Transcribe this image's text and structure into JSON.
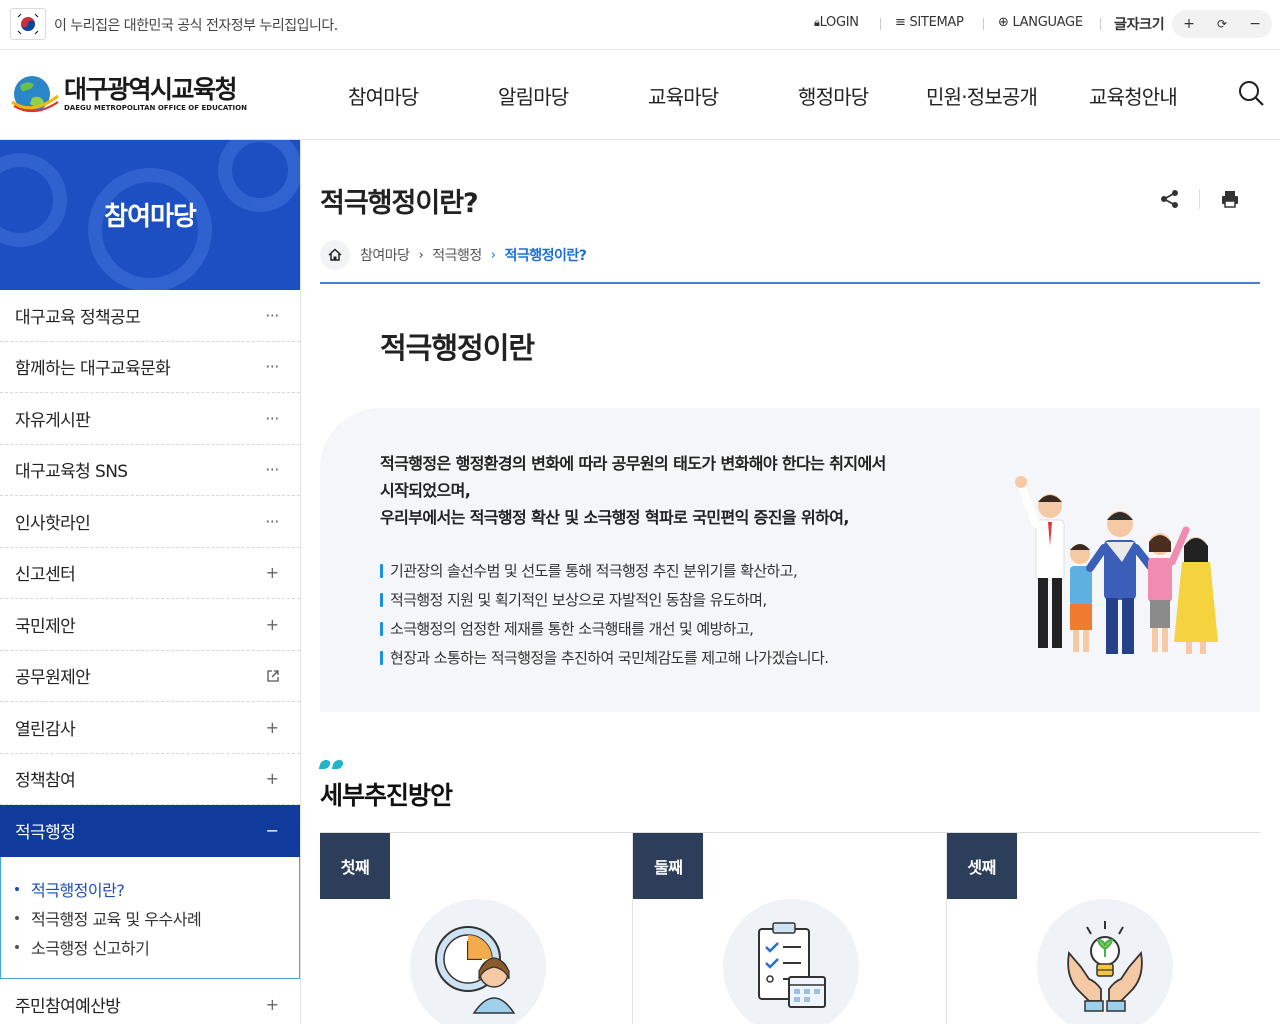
{
  "topbar": {
    "gov_notice": "이 누리집은 대한민국 공식 전자정부 누리집입니다.",
    "login": "LOGIN",
    "sitemap": "SITEMAP",
    "language": "LANGUAGE",
    "font_size_label": "글자크기",
    "font_plus": "+",
    "font_reset": "⟳",
    "font_minus": "−"
  },
  "logo": {
    "title": "대구광역시교육청",
    "subtitle": "DAEGU METROPOLITAN OFFICE OF EDUCATION"
  },
  "gnb": {
    "items": [
      "참여마당",
      "알림마당",
      "교육마당",
      "행정마당",
      "민원·정보공개",
      "교육청안내"
    ]
  },
  "lnb": {
    "title": "참여마당",
    "items": [
      {
        "label": "대구교육 정책공모",
        "mark": "···"
      },
      {
        "label": "함께하는 대구교육문화",
        "mark": "···"
      },
      {
        "label": "자유게시판",
        "mark": "···"
      },
      {
        "label": "대구교육청 SNS",
        "mark": "···"
      },
      {
        "label": "인사핫라인",
        "mark": "···"
      },
      {
        "label": "신고센터",
        "mark": "+"
      },
      {
        "label": "국민제안",
        "mark": "+"
      },
      {
        "label": "공무원제안",
        "mark": "external"
      },
      {
        "label": "열린감사",
        "mark": "+"
      },
      {
        "label": "정책참여",
        "mark": "+"
      },
      {
        "label": "적극행정",
        "mark": "−"
      }
    ],
    "subitems": [
      "적극행정이란?",
      "적극행정 교육 및 우수사례",
      "소극행정 신고하기"
    ],
    "after": {
      "label": "주민참여예산방",
      "mark": "+"
    }
  },
  "content": {
    "page_title": "적극행정이란?",
    "breadcrumb": [
      "참여마당",
      "적극행정",
      "적극행정이란?"
    ],
    "section_title": "적극행정이란",
    "intro_lead_1": "적극행정은 행정환경의 변화에 따라 공무원의 태도가 변화해야 한다는 취지에서",
    "intro_lead_2": "시작되었으며,",
    "intro_lead_3": "우리부에서는 적극행정 확산 및 소극행정 혁파로 국민편익 증진을 위하여,",
    "intro_points": [
      "기관장의 솔선수범 및 선도를 통해 적극행정 추진 분위기를 확산하고,",
      "적극행정 지원 및 획기적인 보상으로 자발적인 동참을 유도하며,",
      "소극행정의 엄정한 제재를 통한 소극행태를 개선 및 예방하고,",
      "현장과 소통하는 적극행정을 추진하여 국민체감도를 제고해 나가겠습니다."
    ],
    "sub_title": "세부추진방안",
    "cards": [
      {
        "tag": "첫째",
        "icon": "clock-person-icon"
      },
      {
        "tag": "둘째",
        "icon": "checklist-icon"
      },
      {
        "tag": "셋째",
        "icon": "lightbulb-hands-icon"
      }
    ]
  },
  "colors": {
    "primary_blue": "#1c4fc2",
    "active_blue": "#103b9c",
    "link_blue": "#1b6fd6",
    "card_tag": "#2c3e59",
    "accent_teal": "#22b3c9"
  }
}
